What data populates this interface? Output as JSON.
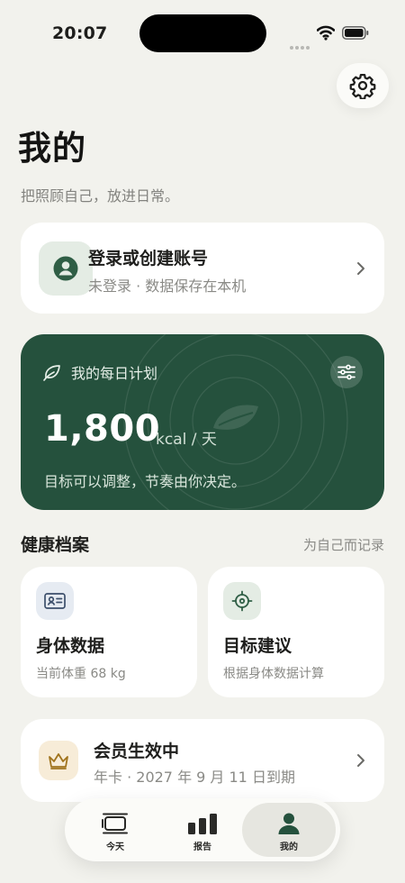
{
  "status_bar": {
    "time": "20:07"
  },
  "header": {
    "title": "我的",
    "subtitle": "把照顾自己，放进日常。"
  },
  "login": {
    "title": "登录或创建账号",
    "subtitle": "未登录 · 数据保存在本机"
  },
  "plan": {
    "title": "我的每日计划",
    "calories": "1,800",
    "unit": "kcal / 天",
    "note": "目标可以调整，节奏由你决定。"
  },
  "health": {
    "title": "健康档案",
    "aside": "为自己而记录",
    "tiles": [
      {
        "title": "身体数据",
        "subtitle": "当前体重 68 kg",
        "icon": "id-card-icon"
      },
      {
        "title": "目标建议",
        "subtitle": "根据身体数据计算",
        "icon": "crosshair-icon"
      }
    ]
  },
  "membership": {
    "title": "会员生效中",
    "subtitle": "年卡 · 2027 年 9 月 11 日到期",
    "icon": "crown-icon"
  },
  "tabs": [
    {
      "label": "今天",
      "icon": "today-icon",
      "active": false
    },
    {
      "label": "报告",
      "icon": "bar-chart-icon",
      "active": false
    },
    {
      "label": "我的",
      "icon": "person-icon",
      "active": true
    }
  ],
  "colors": {
    "background": "#f2f2ed",
    "plan_card": "#25513d",
    "accent_green": "#2f5e45",
    "crown_gold": "#a0731c",
    "id_card_blue": "#3c4f6b"
  }
}
